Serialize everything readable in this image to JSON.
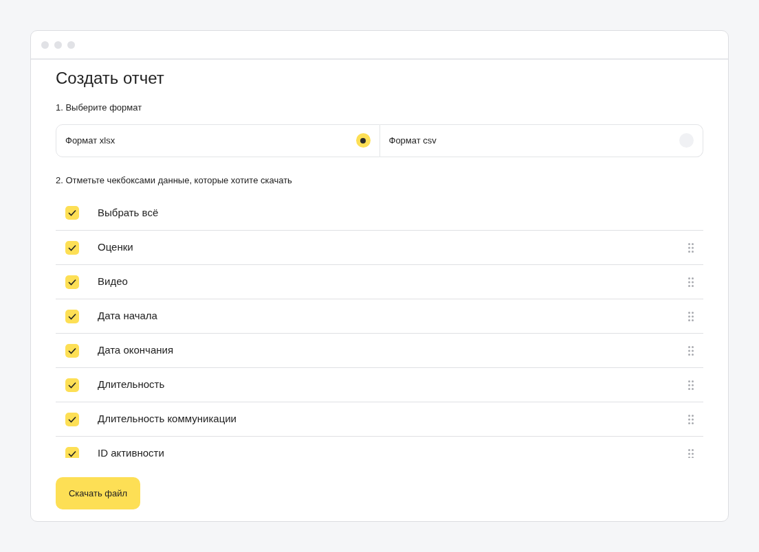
{
  "title": "Создать отчет",
  "format_section": {
    "label": "1. Выберите формат",
    "options": [
      {
        "label": "Формат xlsx",
        "selected": true
      },
      {
        "label": "Формат csv",
        "selected": false
      }
    ]
  },
  "data_section": {
    "label": "2. Отметьте чекбоксами данные, которые хотите скачать",
    "items": [
      {
        "kind": "select_all",
        "label": "Выбрать всё",
        "checked": true
      },
      {
        "kind": "field",
        "label": "Оценки",
        "checked": true
      },
      {
        "kind": "field",
        "label": "Видео",
        "checked": true
      },
      {
        "kind": "field",
        "label": "Дата начала",
        "checked": true
      },
      {
        "kind": "field",
        "label": "Дата окончания",
        "checked": true
      },
      {
        "kind": "field",
        "label": "Длительность",
        "checked": true
      },
      {
        "kind": "field",
        "label": "Длительность коммуникации",
        "checked": true
      },
      {
        "kind": "field",
        "label": "ID активности",
        "checked": true
      }
    ]
  },
  "download_button": "Скачать файл"
}
